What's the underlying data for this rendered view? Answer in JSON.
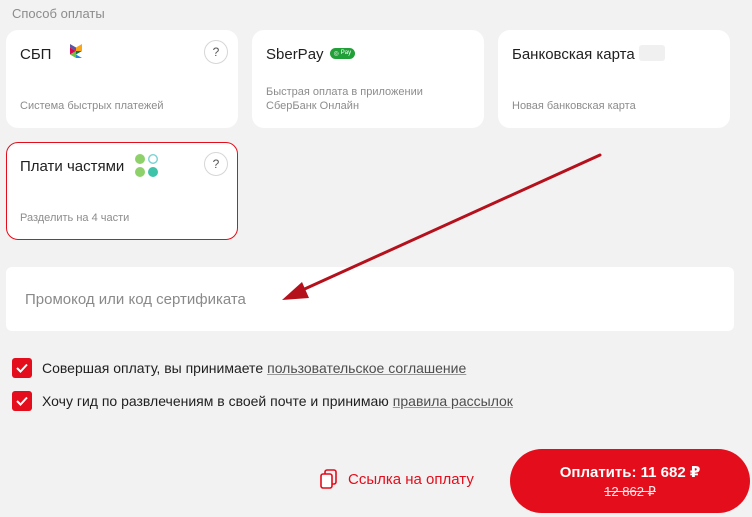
{
  "payment": {
    "section_title": "Способ оплаты",
    "methods": [
      {
        "title": "СБП",
        "description": "Система быстрых платежей",
        "help": "?"
      },
      {
        "title": "SberPay",
        "badge": "Pay",
        "description_line1": "Быстрая оплата в приложении",
        "description_line2": "СберБанк Онлайн"
      },
      {
        "title": "Банковская карта",
        "description": "Новая банковская карта"
      },
      {
        "title": "Плати частями",
        "description": "Разделить на 4 части",
        "help": "?",
        "selected": true
      }
    ]
  },
  "promo": {
    "placeholder": "Промокод или код сертификата",
    "value": ""
  },
  "agreements": [
    {
      "text": "Совершая оплату, вы принимаете",
      "link": "пользовательское соглашение",
      "checked": true
    },
    {
      "text": "Хочу гид по развлечениям в своей почте и принимаю",
      "link": "правила рассылок",
      "checked": true
    }
  ],
  "footer": {
    "payment_link_label": "Ссылка на оплату",
    "pay_button_label": "Оплатить: 11 682 ₽",
    "old_price": "12 862 ₽"
  },
  "colors": {
    "accent": "#e30d1b",
    "page_background": "#f2f2f2",
    "sberpay_green": "#21a038",
    "annotation_arrow": "#b5111c"
  },
  "icons": {
    "sbp": "sbp-logo-icon",
    "installments": "dots-cluster-icon",
    "help": "question-icon",
    "link": "copy-link-icon",
    "check": "checkmark-icon"
  }
}
